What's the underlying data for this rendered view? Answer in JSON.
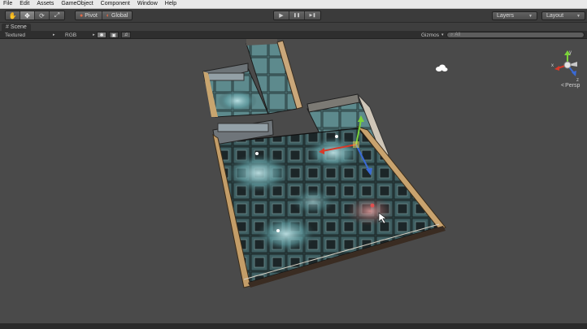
{
  "menu": {
    "items": [
      "File",
      "Edit",
      "Assets",
      "GameObject",
      "Component",
      "Window",
      "Help"
    ]
  },
  "toolbar": {
    "transform_tools": [
      {
        "icon": "hand-icon",
        "glyph": "✋"
      },
      {
        "icon": "move-icon",
        "glyph": "✥"
      },
      {
        "icon": "rotate-icon",
        "glyph": "⟳"
      },
      {
        "icon": "scale-icon",
        "glyph": "⤢"
      }
    ],
    "pivot_label": "Pivot",
    "global_label": "Global",
    "play_icon": "▶",
    "pause_icon": "❚❚",
    "step_icon": "▶❚",
    "layers_label": "Layers",
    "layout_label": "Layout"
  },
  "scene": {
    "tab_label": "Scene",
    "render_mode": "Textured",
    "color_mode": "RGB",
    "gizmos_label": "Gizmos",
    "search_placeholder": "All",
    "projection_label": "Persp",
    "axis_labels": {
      "y": "y",
      "x": "x",
      "z": "z"
    }
  },
  "colors": {
    "menubar_bg": "#e9e9e9",
    "toolbar_bg": "#3b3b3b",
    "viewport_bg": "#4a4a4a",
    "gizmo_x": "#d63a2a",
    "gizmo_y": "#7bd23a",
    "gizmo_z": "#3a6ad6",
    "floor_lit": "#6fb2b6",
    "floor_dark": "#1e2a2c"
  }
}
